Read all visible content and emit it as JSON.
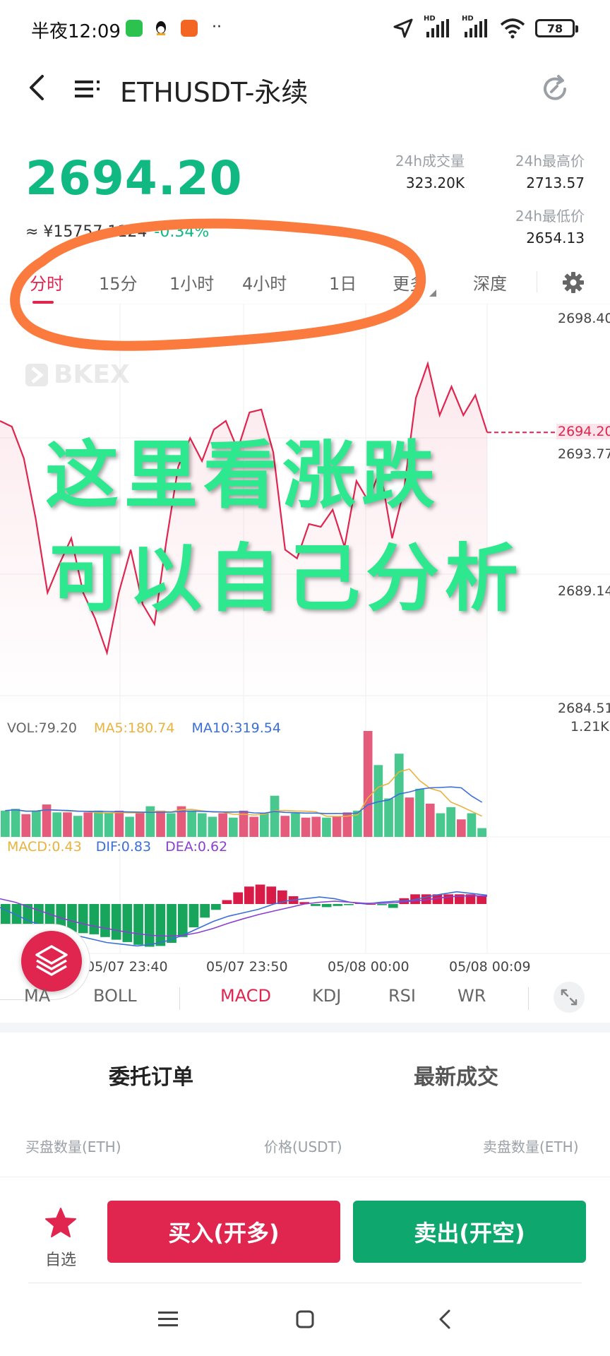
{
  "status_bar": {
    "time": "半夜12:09",
    "battery": "78",
    "net_1": "HD",
    "net_2": "HD"
  },
  "header": {
    "title": "ETHUSDT-永续"
  },
  "ticker": {
    "last_price": "2694.20",
    "cny_prefix": "≈ ¥",
    "cny_value": "15757.1124",
    "change_pct": "-0.34%",
    "volume_label": "24h成交量",
    "volume_value": "323.20K",
    "high_label": "24h最高价",
    "high_value": "2713.57",
    "low_label": "24h最低价",
    "low_value": "2654.13"
  },
  "period_tabs": {
    "items": [
      "分时",
      "15分",
      "1小时",
      "4小时",
      "1日",
      "更多",
      "深度"
    ],
    "active": "分时"
  },
  "chart": {
    "watermark": "BKEX",
    "y_labels": [
      "2698.40",
      "2693.77",
      "2689.14",
      "2684.51"
    ],
    "current_price_tag": "2694.20",
    "vol_axis_label": "1.21K",
    "x_labels": [
      "05/07 23:40",
      "05/07 23:50",
      "05/08 00:00",
      "05/08 00:09"
    ],
    "vol_legend": {
      "vol": "VOL:79.20",
      "ma5": "MA5:180.74",
      "ma10": "MA10:319.54"
    },
    "macd_legend": {
      "macd": "MACD:0.43",
      "dif": "DIF:0.83",
      "dea": "DEA:0.62"
    }
  },
  "chart_data": {
    "type": "line",
    "price_series": {
      "name": "分时",
      "values": [
        2694.6,
        2694.4,
        2693.3,
        2691.2,
        2688.6,
        2689.6,
        2690.5,
        2688.6,
        2687.7,
        2686.5,
        2688.6,
        2690.1,
        2688.2,
        2687.5,
        2690.4,
        2693.0,
        2694.0,
        2693.2,
        2694.3,
        2694.6,
        2693.6,
        2694.9,
        2695.0,
        2693.5,
        2690.1,
        2689.8,
        2691.0,
        2690.9,
        2691.5,
        2690.2,
        2692.5,
        2691.8,
        2692.9,
        2690.5,
        2692.2,
        2695.4,
        2696.6,
        2694.8,
        2695.8,
        2694.8,
        2695.5,
        2694.2
      ],
      "ylim": [
        2684.51,
        2698.4
      ]
    },
    "volume_series": {
      "name": "VOL",
      "values": [
        0.3,
        0.32,
        0.26,
        0.3,
        0.37,
        0.28,
        0.28,
        0.24,
        0.28,
        0.3,
        0.27,
        0.3,
        0.23,
        0.28,
        0.35,
        0.3,
        0.27,
        0.35,
        0.3,
        0.27,
        0.23,
        0.27,
        0.22,
        0.3,
        0.23,
        0.27,
        0.47,
        0.24,
        0.27,
        0.22,
        0.23,
        0.22,
        0.23,
        0.28,
        0.3,
        1.21,
        0.82,
        0.44,
        0.95,
        0.45,
        0.55,
        0.38,
        0.27,
        0.34,
        0.2,
        0.27,
        0.1
      ],
      "up": [
        1,
        1,
        0,
        1,
        0,
        1,
        0,
        1,
        0,
        1,
        1,
        0,
        1,
        0,
        1,
        0,
        1,
        0,
        1,
        1,
        1,
        0,
        1,
        0,
        0,
        1,
        1,
        0,
        1,
        0,
        0,
        1,
        0,
        0,
        1,
        0,
        1,
        1,
        1,
        0,
        1,
        0,
        1,
        1,
        0,
        1,
        1
      ]
    },
    "macd_series": {
      "hist": [
        -0.55,
        -0.6,
        -0.62,
        -0.65,
        -0.68,
        -0.7,
        -0.72,
        -0.75,
        -0.78,
        -0.85,
        -0.92,
        -0.98,
        -1.05,
        -1.1,
        -1.08,
        -1.0,
        -0.85,
        -0.6,
        -0.35,
        -0.15,
        0.1,
        0.3,
        0.45,
        0.5,
        0.45,
        0.35,
        0.2,
        0.05,
        -0.05,
        -0.08,
        -0.05,
        -0.03,
        0.02,
        0.0,
        -0.03,
        -0.1,
        0.15,
        0.25,
        0.25,
        0.25,
        0.25,
        0.25,
        0.25,
        0.22
      ],
      "dif": [
        -0.1,
        -0.3,
        -0.5,
        -0.65,
        -0.78,
        -0.9,
        -1.0,
        -1.1,
        -1.15,
        -1.2,
        -1.15,
        -1.05,
        -0.9,
        -0.7,
        -0.5,
        -0.35,
        -0.25,
        -0.15,
        0.0,
        0.1,
        0.15,
        0.2,
        0.15,
        0.05,
        0.0,
        0.05,
        0.08,
        0.1,
        0.2,
        0.28,
        0.35,
        0.3,
        0.25
      ],
      "dea": [
        0.15,
        0.05,
        -0.1,
        -0.25,
        -0.4,
        -0.52,
        -0.62,
        -0.7,
        -0.78,
        -0.85,
        -0.9,
        -0.92,
        -0.9,
        -0.82,
        -0.7,
        -0.55,
        -0.42,
        -0.3,
        -0.2,
        -0.1,
        0.0,
        0.05,
        0.08,
        0.05,
        0.02,
        0.02,
        0.04,
        0.08,
        0.12,
        0.18,
        0.22,
        0.24,
        0.22
      ]
    }
  },
  "annotation": {
    "line1": "这里看涨跌",
    "line2": "可以自己分析"
  },
  "indicator_tabs": {
    "main": [
      "MA",
      "BOLL"
    ],
    "sub": [
      "MACD",
      "KDJ",
      "RSI",
      "WR"
    ],
    "active": "MACD"
  },
  "order_section": {
    "tab_orders": "委托订单",
    "tab_trades": "最新成交",
    "col_bid_qty": "买盘数量(ETH)",
    "col_price": "价格(USDT)",
    "col_ask_qty": "卖盘数量(ETH)"
  },
  "actions": {
    "favorite_label": "自选",
    "buy_label": "买入(开多)",
    "sell_label": "卖出(开空)"
  },
  "colors": {
    "up": "#10b981",
    "down": "#e0254f",
    "accent": "#e0254f",
    "annotation_ring": "#fb7a3d",
    "annotation_text": "#2ee88f"
  }
}
